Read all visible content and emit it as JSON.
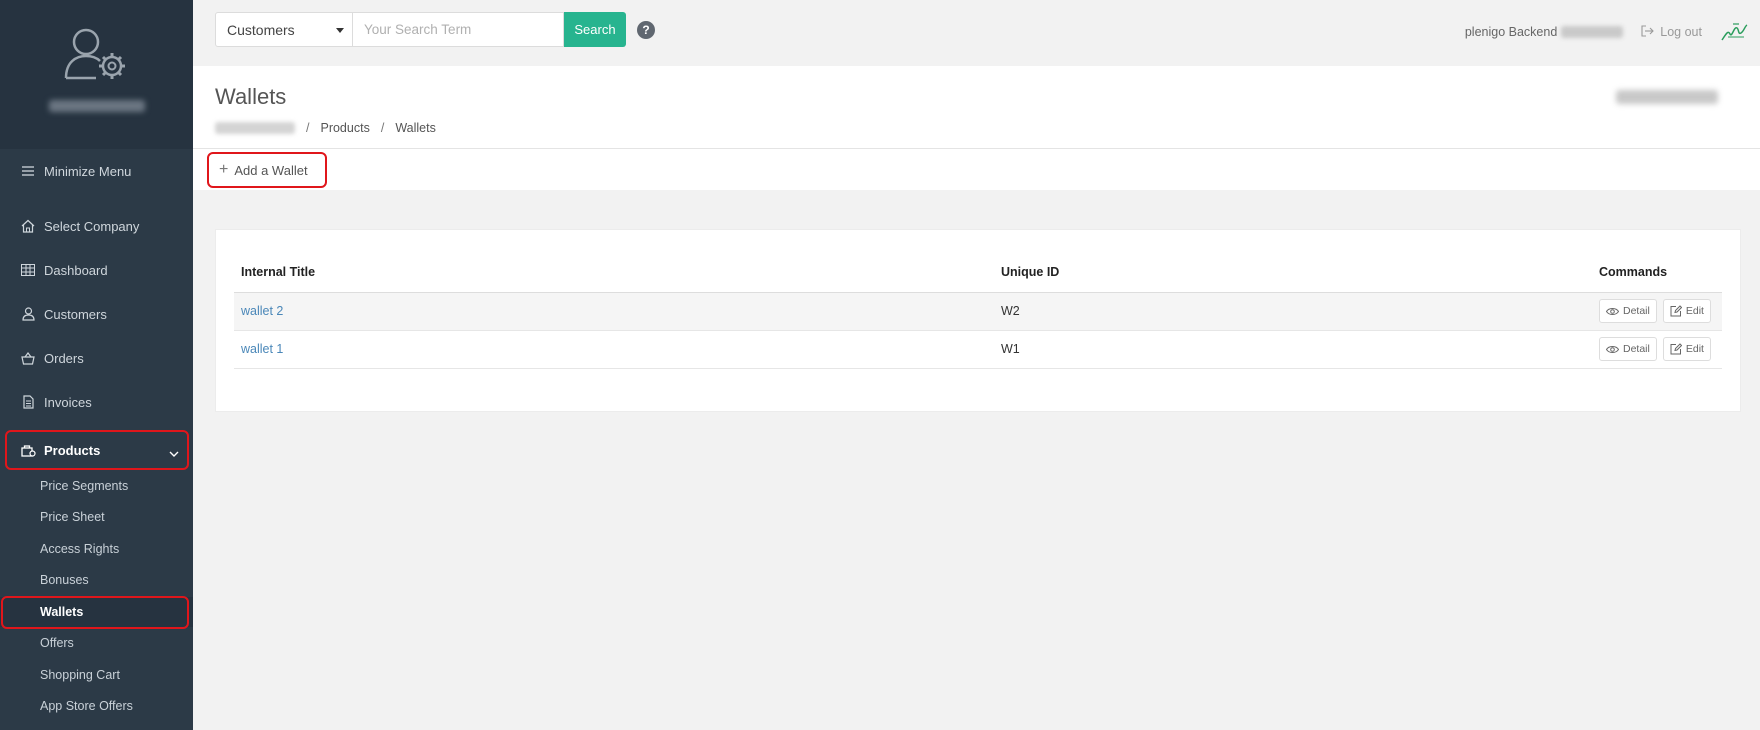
{
  "sidebar": {
    "minimize_label": "Minimize Menu",
    "items": [
      {
        "label": "Select Company",
        "icon": "home-icon"
      },
      {
        "label": "Dashboard",
        "icon": "grid-icon"
      },
      {
        "label": "Customers",
        "icon": "user-icon"
      },
      {
        "label": "Orders",
        "icon": "basket-icon"
      },
      {
        "label": "Invoices",
        "icon": "document-icon"
      },
      {
        "label": "Products",
        "icon": "products-icon",
        "active": true
      }
    ],
    "sub_items": [
      {
        "label": "Price Segments"
      },
      {
        "label": "Price Sheet"
      },
      {
        "label": "Access Rights"
      },
      {
        "label": "Bonuses"
      },
      {
        "label": "Wallets",
        "active": true
      },
      {
        "label": "Offers"
      },
      {
        "label": "Shopping Cart"
      },
      {
        "label": "App Store Offers"
      }
    ]
  },
  "topbar": {
    "search_scope": "Customers",
    "search_placeholder": "Your Search Term",
    "search_button": "Search",
    "help": "?",
    "backend_label": "plenigo Backend",
    "logout_label": "Log out"
  },
  "page": {
    "title": "Wallets",
    "breadcrumb": [
      "Products",
      "Wallets"
    ]
  },
  "toolbar": {
    "add_label": "Add a Wallet"
  },
  "table": {
    "headers": [
      "Internal Title",
      "Unique ID",
      "Commands"
    ],
    "rows": [
      {
        "title": "wallet 2",
        "id": "W2"
      },
      {
        "title": "wallet 1",
        "id": "W1"
      }
    ],
    "detail_label": "Detail",
    "edit_label": "Edit"
  },
  "colors": {
    "sidebar_bg": "#2c3a47",
    "accent": "#27b48f",
    "highlight": "#e0161b",
    "link": "#4a87b8"
  }
}
